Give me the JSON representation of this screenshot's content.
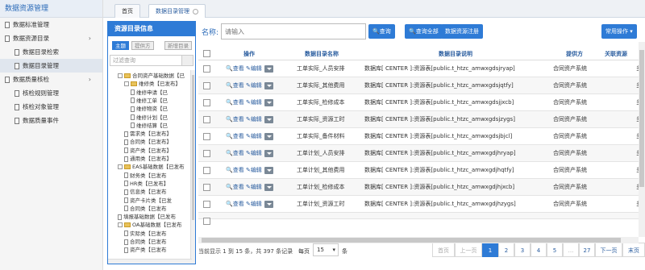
{
  "app_title": "数据资源管理",
  "sidebar": {
    "items": [
      {
        "label": "数据标准管理",
        "type": "group"
      },
      {
        "label": "数据资源目录",
        "type": "group",
        "chev": "›"
      },
      {
        "label": "数据目录检索",
        "type": "item"
      },
      {
        "label": "数据目录管理",
        "type": "item",
        "active": true
      },
      {
        "label": "数据质量核检",
        "type": "group",
        "chev": "›"
      },
      {
        "label": "核检规则管理",
        "type": "item"
      },
      {
        "label": "核检对象管理",
        "type": "item"
      },
      {
        "label": "数据质量事件",
        "type": "item"
      }
    ]
  },
  "tabs": [
    {
      "label": "首页"
    },
    {
      "label": "数据目录管理",
      "active": true
    }
  ],
  "tree_panel": {
    "title": "资源目录信息",
    "btn_theme": "主题",
    "btn_provider": "提供方",
    "btn_add": "新增目录",
    "filter_placeholder": "过滤查询",
    "nodes": [
      {
        "label": "合同资产基础数据【已",
        "depth": 1,
        "kind": "folder"
      },
      {
        "label": "维修类【已发布】",
        "depth": 2,
        "kind": "folder"
      },
      {
        "label": "维修申请【已",
        "depth": 3,
        "kind": "file"
      },
      {
        "label": "维修工单【已",
        "depth": 3,
        "kind": "file"
      },
      {
        "label": "维修物资【已",
        "depth": 3,
        "kind": "file"
      },
      {
        "label": "维修计划【已",
        "depth": 3,
        "kind": "file"
      },
      {
        "label": "维修结算【已",
        "depth": 3,
        "kind": "file"
      },
      {
        "label": "需求类【已发布】",
        "depth": 2,
        "kind": "file"
      },
      {
        "label": "合同类【已发布】",
        "depth": 2,
        "kind": "file"
      },
      {
        "label": "资产类【已发布】",
        "depth": 2,
        "kind": "file"
      },
      {
        "label": "通用类【已发布】",
        "depth": 2,
        "kind": "file"
      },
      {
        "label": "EAS基础数据【已发布",
        "depth": 1,
        "kind": "folder"
      },
      {
        "label": "财务类【已发布",
        "depth": 2,
        "kind": "file"
      },
      {
        "label": "HR类【已发布】",
        "depth": 2,
        "kind": "file"
      },
      {
        "label": "信息类【已发布",
        "depth": 2,
        "kind": "file"
      },
      {
        "label": "资产卡片类【已发",
        "depth": 2,
        "kind": "file"
      },
      {
        "label": "合同类【已发布",
        "depth": 2,
        "kind": "file"
      },
      {
        "label": "填报基础数据【已发布",
        "depth": 1,
        "kind": "file"
      },
      {
        "label": "OA基础数据【已发布",
        "depth": 1,
        "kind": "folder"
      },
      {
        "label": "实际类【已发布",
        "depth": 2,
        "kind": "file"
      },
      {
        "label": "合同类【已发布",
        "depth": 2,
        "kind": "file"
      },
      {
        "label": "资产类【已发布",
        "depth": 2,
        "kind": "file"
      }
    ]
  },
  "search": {
    "label": "名称:",
    "placeholder": "请输入",
    "btn_query": "查询",
    "btn_query_all": "查询全部",
    "btn_register": "数据资源注册",
    "btn_common": "常用操作"
  },
  "table": {
    "headers": {
      "ops": "操作",
      "name": "数据目录名称",
      "desc": "数据目录说明",
      "provider": "提供方",
      "related": "关联资源"
    },
    "view_label": "查看",
    "edit_label": "编辑",
    "rows": [
      {
        "name": "工单实际_人员安排",
        "desc": "数据库[ CENTER ]:资源表[public.t_htzc_amwxgdsjryap]",
        "provider": "合同资产系统",
        "related": "多"
      },
      {
        "name": "工单实际_其他费用",
        "desc": "数据库[ CENTER ]:资源表[public.t_htzc_amwxgdsjqtfy]",
        "provider": "合同资产系统",
        "related": "多"
      },
      {
        "name": "工单实际_检修成本",
        "desc": "数据库[ CENTER ]:资源表[public.t_htzc_amwxgdsjjxcb]",
        "provider": "合同资产系统",
        "related": "多"
      },
      {
        "name": "工单实际_资源工时",
        "desc": "数据库[ CENTER ]:资源表[public.t_htzc_amwxgdsjzygs]",
        "provider": "合同资产系统",
        "related": "多"
      },
      {
        "name": "工单实际_备件材料",
        "desc": "数据库[ CENTER ]:资源表[public.t_htzc_amwxgdsjbjcl]",
        "provider": "合同资产系统",
        "related": "多"
      },
      {
        "name": "工单计划_人员安排",
        "desc": "数据库[ CENTER ]:资源表[public.t_htzc_amwxgdjhryap]",
        "provider": "合同资产系统",
        "related": "多"
      },
      {
        "name": "工单计划_其他费用",
        "desc": "数据库[ CENTER ]:资源表[public.t_htzc_amwxgdjhqtfy]",
        "provider": "合同资产系统",
        "related": "多"
      },
      {
        "name": "工单计划_检修成本",
        "desc": "数据库[ CENTER ]:资源表[public.t_htzc_amwxgdjhjxcb]",
        "provider": "合同资产系统",
        "related": "多"
      },
      {
        "name": "工单计划_资源工时",
        "desc": "数据库[ CENTER ]:资源表[public.t_htzc_amwxgdjhzygs]",
        "provider": "合同资产系统",
        "related": "多"
      },
      {
        "name": "",
        "desc": "",
        "provider": "",
        "related": "",
        "partial": true
      }
    ]
  },
  "pagination": {
    "info": "当前显示 1 到 15 条，共 397 条记录",
    "per_page_label": "每页",
    "per_page_value": "15",
    "per_page_unit": "条",
    "first": "首页",
    "prev": "上一页",
    "pages": [
      "1",
      "2",
      "3",
      "4",
      "5",
      "...",
      "27"
    ],
    "current": "1",
    "next": "下一页",
    "last": "末页"
  },
  "colors": {
    "accent": "#2e7bd6",
    "link": "#2a5d9f"
  }
}
